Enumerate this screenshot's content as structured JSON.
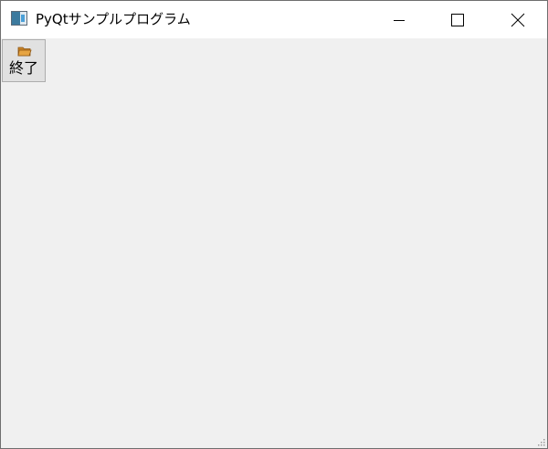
{
  "window": {
    "title": "PyQtサンプルプログラム",
    "controls": {
      "minimize": "minimize-icon",
      "maximize": "maximize-icon",
      "close": "close-icon"
    }
  },
  "toolbar": {
    "exit_label": "終了",
    "exit_icon": "folder-icon"
  },
  "colors": {
    "titlebar": "#ffffff",
    "client_background": "#f0f0f0",
    "button_face": "#e1e1e1"
  }
}
